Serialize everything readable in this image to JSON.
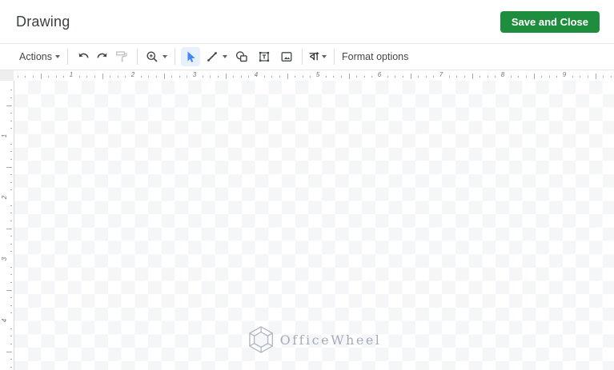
{
  "header": {
    "title": "Drawing",
    "save_button_label": "Save and Close"
  },
  "toolbar": {
    "actions_label": "Actions",
    "format_options_label": "Format options",
    "input_tools_label": "বা",
    "icon_names": [
      "actions-dropdown",
      "undo-icon",
      "redo-icon",
      "paint-format-icon",
      "zoom-icon",
      "select-icon",
      "line-icon",
      "shape-icon",
      "text-box-icon",
      "image-icon",
      "input-tools-icon"
    ],
    "selected_tool": "select"
  },
  "rulers": {
    "unit": "inches",
    "horizontal_numbers": [
      "1",
      "2",
      "3",
      "4",
      "5",
      "6",
      "7",
      "8",
      "9"
    ],
    "vertical_numbers": [
      "1",
      "2",
      "3",
      "4"
    ]
  },
  "canvas": {
    "watermark_text": "OfficeWheel"
  },
  "colors": {
    "save_button_green": "#1e8e3e",
    "selected_tool_blue": "#4285f4",
    "selected_tool_bg": "#e8f0fe",
    "checker_gray": "#f5f6f7",
    "toolbar_icon_gray": "#444746",
    "watermark_gray": "#959daf"
  }
}
